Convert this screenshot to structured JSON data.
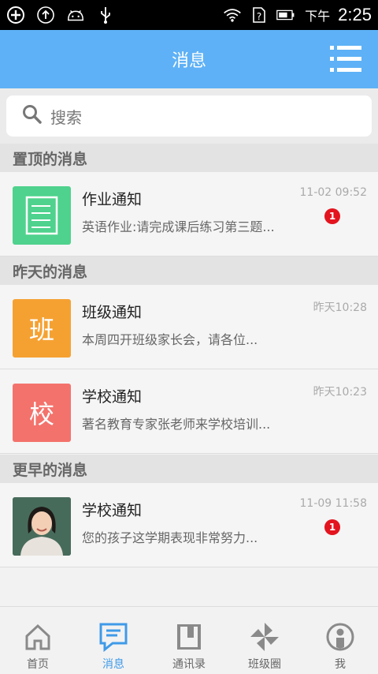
{
  "status_bar": {
    "time_prefix": "下午",
    "time": "2:25"
  },
  "header": {
    "title": "消息"
  },
  "search": {
    "placeholder": "搜索"
  },
  "sections": [
    {
      "label": "置顶的消息"
    },
    {
      "label": "昨天的消息"
    },
    {
      "label": "更早的消息"
    }
  ],
  "messages": [
    {
      "title": "作业通知",
      "preview": "英语作业:请完成课后练习第三题...",
      "time": "11-02 09:52",
      "badge": "1",
      "avatar_color": "#4fd28d",
      "avatar_icon": "notebook-icon"
    },
    {
      "title": "班级通知",
      "preview": "本周四开班级家长会，请各位...",
      "time": "昨天10:28",
      "avatar_text": "班",
      "avatar_color": "#f5a132"
    },
    {
      "title": "学校通知",
      "preview": "著名教育专家张老师来学校培训...",
      "time": "昨天10:23",
      "avatar_text": "校",
      "avatar_color": "#f4726c"
    },
    {
      "title": "学校通知",
      "preview": "您的孩子这学期表现非常努力...",
      "time": "11-09 11:58",
      "badge": "1",
      "avatar_icon": "teacher-photo"
    }
  ],
  "bottom_nav": [
    {
      "label": "首页",
      "icon": "home-icon"
    },
    {
      "label": "消息",
      "icon": "message-icon",
      "active": true
    },
    {
      "label": "通讯录",
      "icon": "contacts-book-icon"
    },
    {
      "label": "班级圈",
      "icon": "pinwheel-icon"
    },
    {
      "label": "我",
      "icon": "profile-icon"
    }
  ],
  "colors": {
    "primary": "#5eb1f6",
    "active_nav": "#3f9ae8",
    "badge": "#e3141e"
  }
}
